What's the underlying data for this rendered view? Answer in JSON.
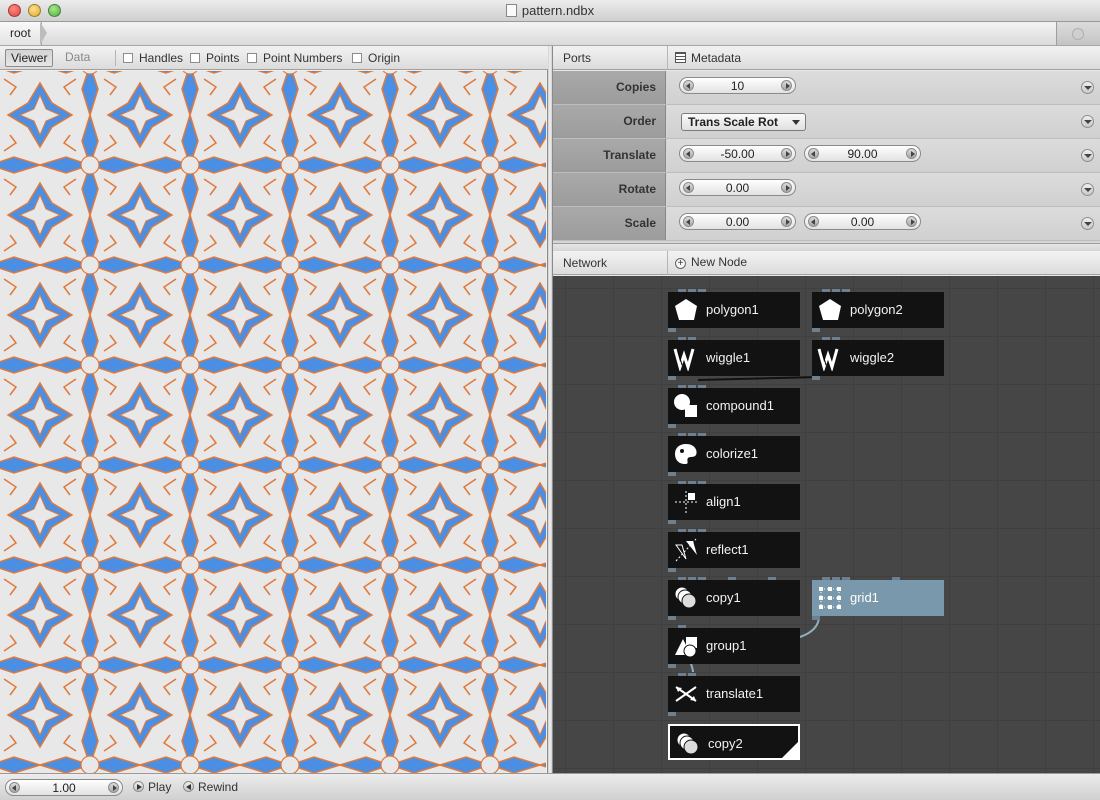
{
  "window": {
    "title": "pattern.ndbx"
  },
  "breadcrumb": {
    "root": "root"
  },
  "viewer": {
    "tabs": [
      "Viewer",
      "Data"
    ],
    "options": [
      "Handles",
      "Points",
      "Point Numbers",
      "Origin"
    ],
    "pattern_colors": {
      "fill": "#e8e8e8",
      "blue": "#4a8fe3",
      "orange": "#e0793a"
    }
  },
  "ports": {
    "header": "Ports",
    "metadata": "Metadata",
    "rows": [
      {
        "label": "Copies",
        "values": [
          "10"
        ]
      },
      {
        "label": "Order",
        "select": "Trans Scale Rot"
      },
      {
        "label": "Translate",
        "values": [
          "-50.00",
          "90.00"
        ]
      },
      {
        "label": "Rotate",
        "values": [
          "0.00"
        ]
      },
      {
        "label": "Scale",
        "values": [
          "0.00",
          "0.00"
        ]
      }
    ]
  },
  "network": {
    "header": "Network",
    "new_node": "New Node",
    "nodes": [
      {
        "name": "polygon1",
        "icon": "polygon-icon"
      },
      {
        "name": "polygon2",
        "icon": "polygon-icon"
      },
      {
        "name": "wiggle1",
        "icon": "wiggle-icon"
      },
      {
        "name": "wiggle2",
        "icon": "wiggle-icon"
      },
      {
        "name": "compound1",
        "icon": "compound-icon"
      },
      {
        "name": "colorize1",
        "icon": "colorize-icon"
      },
      {
        "name": "align1",
        "icon": "align-icon"
      },
      {
        "name": "reflect1",
        "icon": "reflect-icon"
      },
      {
        "name": "copy1",
        "icon": "copy-icon"
      },
      {
        "name": "grid1",
        "icon": "grid-icon",
        "selected": true
      },
      {
        "name": "group1",
        "icon": "group-icon"
      },
      {
        "name": "translate1",
        "icon": "translate-icon"
      },
      {
        "name": "copy2",
        "icon": "copy-icon",
        "rendered": true
      }
    ],
    "colors": {
      "node": "#121212",
      "selected": "#7a98ab",
      "wire": "#8fb0c4",
      "canvas": "#464646"
    }
  },
  "bottombar": {
    "frame": "1.00",
    "play": "Play",
    "rewind": "Rewind"
  }
}
